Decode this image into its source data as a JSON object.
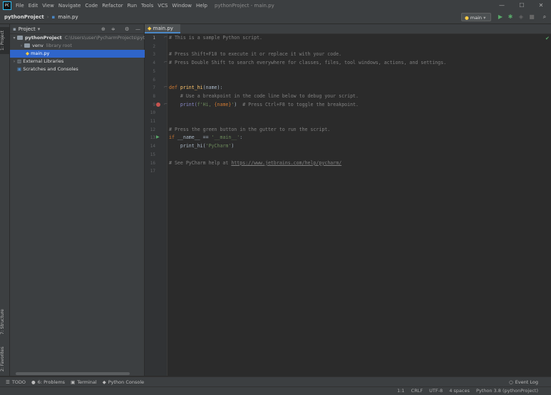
{
  "window": {
    "title": "pythonProject - main.py",
    "app_icon": "PC",
    "menu": [
      "File",
      "Edit",
      "View",
      "Navigate",
      "Code",
      "Refactor",
      "Run",
      "Tools",
      "VCS",
      "Window",
      "Help"
    ],
    "controls": {
      "minimize": "—",
      "maximize": "☐",
      "close": "✕"
    }
  },
  "navbar": {
    "project": "pythonProject",
    "file": "main.py",
    "run_config": "main"
  },
  "project_panel": {
    "title": "Project",
    "tree": [
      {
        "label": "pythonProject",
        "suffix": "C:\\Users\\user\\PycharmProjects\\pyth"
      },
      {
        "label": "venv",
        "suffix": "library root"
      },
      {
        "label": "main.py"
      },
      {
        "label": "External Libraries"
      },
      {
        "label": "Scratches and Consoles"
      }
    ]
  },
  "left_stripe": {
    "project_tab": "1: Project",
    "structure_tab": "7: Structure",
    "favorites_tab": "2: Favorites"
  },
  "editor": {
    "tab_label": "main.py",
    "line_numbers": [
      "1",
      "2",
      "3",
      "4",
      "5",
      "6",
      "7",
      "8",
      "9",
      "10",
      "11",
      "12",
      "13",
      "14",
      "15",
      "16",
      "17"
    ],
    "code": {
      "l1": "# This is a sample Python script.",
      "l3": "# Press Shift+F10 to execute it or replace it with your code.",
      "l4": "# Press Double Shift to search everywhere for classes, files, tool windows, actions, and settings.",
      "l7_kw": "def ",
      "l7_fn": "print_hi",
      "l7_rest": "(name):",
      "l8": "    # Use a breakpoint in the code line below to debug your script.",
      "l9_pre": "    print(",
      "l9_str": "f'Hi, ",
      "l9_var": "{name}",
      "l9_end": "'",
      "l9_close": ")  ",
      "l9_cm": "# Press Ctrl+F8 to toggle the breakpoint.",
      "l12": "# Press the green button in the gutter to run the script.",
      "l13_kw": "if ",
      "l13_mid": "__name__ == ",
      "l13_str": "'__main__'",
      "l13_end": ":",
      "l14_pre": "    print_hi(",
      "l14_str": "'PyCharm'",
      "l14_end": ")",
      "l16_pre": "# See PyCharm help at ",
      "l16_link": "https://www.jetbrains.com/help/pycharm/"
    }
  },
  "bottom_tools": [
    "TODO",
    "6: Problems",
    "Terminal",
    "Python Console"
  ],
  "event_log": "Event Log",
  "status": {
    "position": "1:1",
    "line_sep": "CRLF",
    "encoding": "UTF-8",
    "indent": "4 spaces",
    "interpreter": "Python 3.8 (pythonProject)"
  },
  "colors": {
    "accent": "#2f65ca",
    "breakpoint": "#c75450",
    "run_green": "#59a869"
  }
}
